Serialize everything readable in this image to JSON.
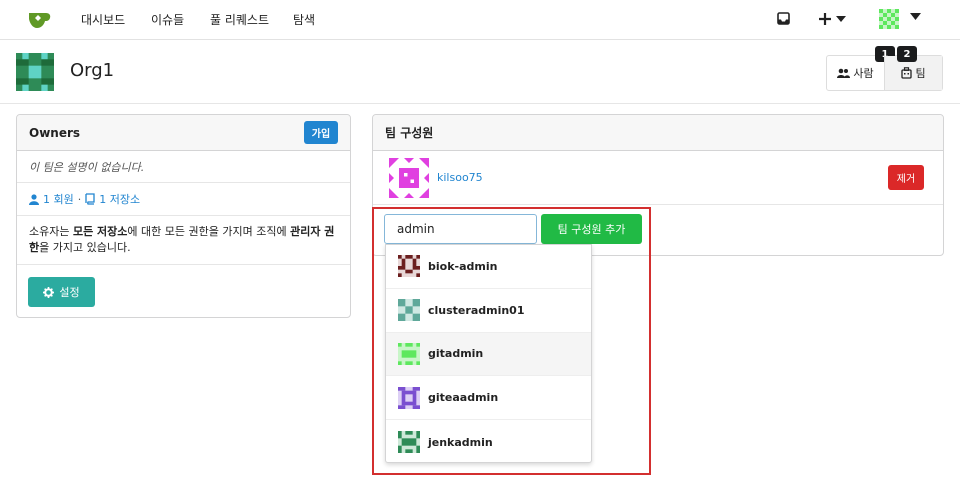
{
  "nav": {
    "items": [
      "대시보드",
      "이슈들",
      "풀 리퀘스트",
      "탐색"
    ]
  },
  "header": {
    "org_name": "Org1",
    "people_label": "사람",
    "people_count": "1",
    "teams_label": "팀",
    "teams_count": "2"
  },
  "owners": {
    "title": "Owners",
    "join_label": "가입",
    "description": "이 팀은 설명이 없습니다.",
    "members_link": "1 회원",
    "separator": "·",
    "repos_link": "1 저장소",
    "permission_parts": [
      "소유자는 ",
      "모든 저장소",
      "에 대한 모든 권한을 가지며 조직에 ",
      "관리자 권한",
      "을 가지고 있습니다."
    ],
    "settings_label": "설정"
  },
  "members": {
    "title": "팀 구성원",
    "member_name": "kilsoo75",
    "remove_label": "제거",
    "search_value": "admin",
    "add_label": "팀 구성원 추가"
  },
  "dropdown": {
    "items": [
      {
        "name": "biok-admin",
        "color": "#6b1e1e"
      },
      {
        "name": "clusteradmin01",
        "color": "#5fa89a"
      },
      {
        "name": "gitadmin",
        "color": "#5ee85e"
      },
      {
        "name": "giteaadmin",
        "color": "#7a4fd0"
      },
      {
        "name": "jenkadmin",
        "color": "#2e8b57"
      }
    ]
  },
  "colors": {
    "primary": "#2185d0",
    "danger": "#db2828",
    "success": "#21ba45",
    "teal": "#2baba0",
    "highlight": "#d32f2f"
  }
}
